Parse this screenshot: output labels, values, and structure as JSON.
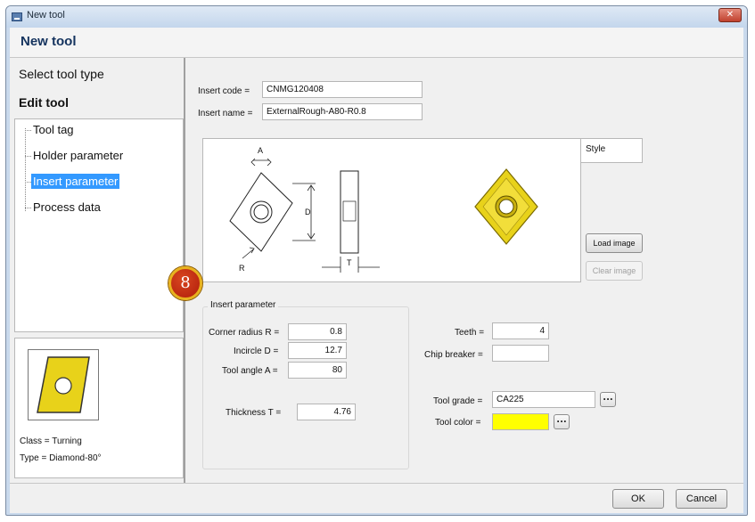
{
  "window": {
    "title": "New tool",
    "close_label": "✕"
  },
  "header": {
    "title": "New tool"
  },
  "steps": {
    "select": "Select tool type",
    "edit": "Edit tool"
  },
  "tree": {
    "items": [
      {
        "label": "Tool tag"
      },
      {
        "label": "Holder parameter"
      },
      {
        "label": "Insert parameter",
        "selected": true
      },
      {
        "label": "Process data"
      }
    ]
  },
  "thumbnail": {
    "class_text": "Class = Turning",
    "type_text": "Type = Diamond-80°"
  },
  "insert": {
    "code_label": "Insert code =",
    "code_value": "CNMG120408",
    "name_label": "Insert name =",
    "name_value": "ExternalRough-A80-R0.8"
  },
  "preview": {
    "style_label": "Style",
    "load_image": "Load image",
    "clear_image": "Clear image",
    "dim_labels": {
      "A": "A",
      "D": "D",
      "R": "R",
      "T": "T"
    }
  },
  "badge": {
    "number": "8"
  },
  "params": {
    "group_title": "Insert parameter",
    "corner_radius_label": "Corner radius R =",
    "corner_radius": "0.8",
    "incircle_label": "Incircle D =",
    "incircle": "12.7",
    "tool_angle_label": "Tool angle A =",
    "tool_angle": "80",
    "thickness_label": "Thickness T =",
    "thickness": "4.76",
    "teeth_label": "Teeth =",
    "teeth": "4",
    "chip_breaker_label": "Chip breaker =",
    "chip_breaker": "",
    "tool_grade_label": "Tool grade =",
    "tool_grade": "CA225",
    "tool_color_label": "Tool color =",
    "tool_color": "#ffff00",
    "ellipsis": "..."
  },
  "footer": {
    "ok": "OK",
    "cancel": "Cancel"
  },
  "colors": {
    "insert_yellow": "#e8d21a",
    "selection": "#3399ff",
    "header_text": "#14335e"
  }
}
